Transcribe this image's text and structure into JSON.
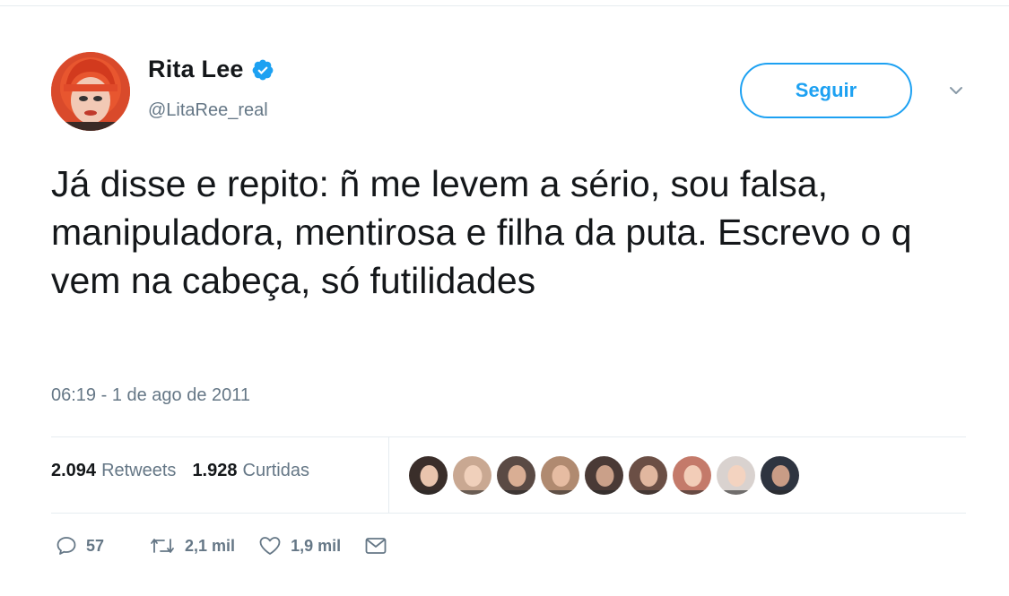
{
  "profile": {
    "display_name": "Rita Lee",
    "handle": "@LitaRee_real",
    "verified": true,
    "avatar": "profile-photo-red-hair"
  },
  "follow_button": {
    "label": "Seguir"
  },
  "menu": {
    "icon": "chevron-down-icon"
  },
  "tweet": {
    "text": "Já disse e repito: ñ me levem a sério, sou falsa, manipuladora, mentirosa e  filha da puta. Escrevo o q vem na cabeça, só futilidades",
    "timestamp": "06:19 - 1 de ago de 2011"
  },
  "stats": {
    "retweets_count": "2.094",
    "retweets_label": "Retweets",
    "likes_count": "1.928",
    "likes_label": "Curtidas"
  },
  "likers": [
    {
      "avatar": "liker-1",
      "color": "#3a2e2a"
    },
    {
      "avatar": "liker-2",
      "color": "#c9a892"
    },
    {
      "avatar": "liker-3",
      "color": "#5a4a44"
    },
    {
      "avatar": "liker-4",
      "color": "#b08a70"
    },
    {
      "avatar": "liker-5",
      "color": "#4a3a36"
    },
    {
      "avatar": "liker-6",
      "color": "#6b4f45"
    },
    {
      "avatar": "liker-7",
      "color": "#c47a6a"
    },
    {
      "avatar": "liker-8",
      "color": "#d9d2cf"
    },
    {
      "avatar": "liker-9",
      "color": "#2e3440"
    }
  ],
  "actions": {
    "replies": "57",
    "retweets": "2,1 mil",
    "likes": "1,9 mil"
  },
  "colors": {
    "accent": "#1da1f2",
    "text": "#14171a",
    "muted": "#657786",
    "border": "#e6ecf0"
  }
}
